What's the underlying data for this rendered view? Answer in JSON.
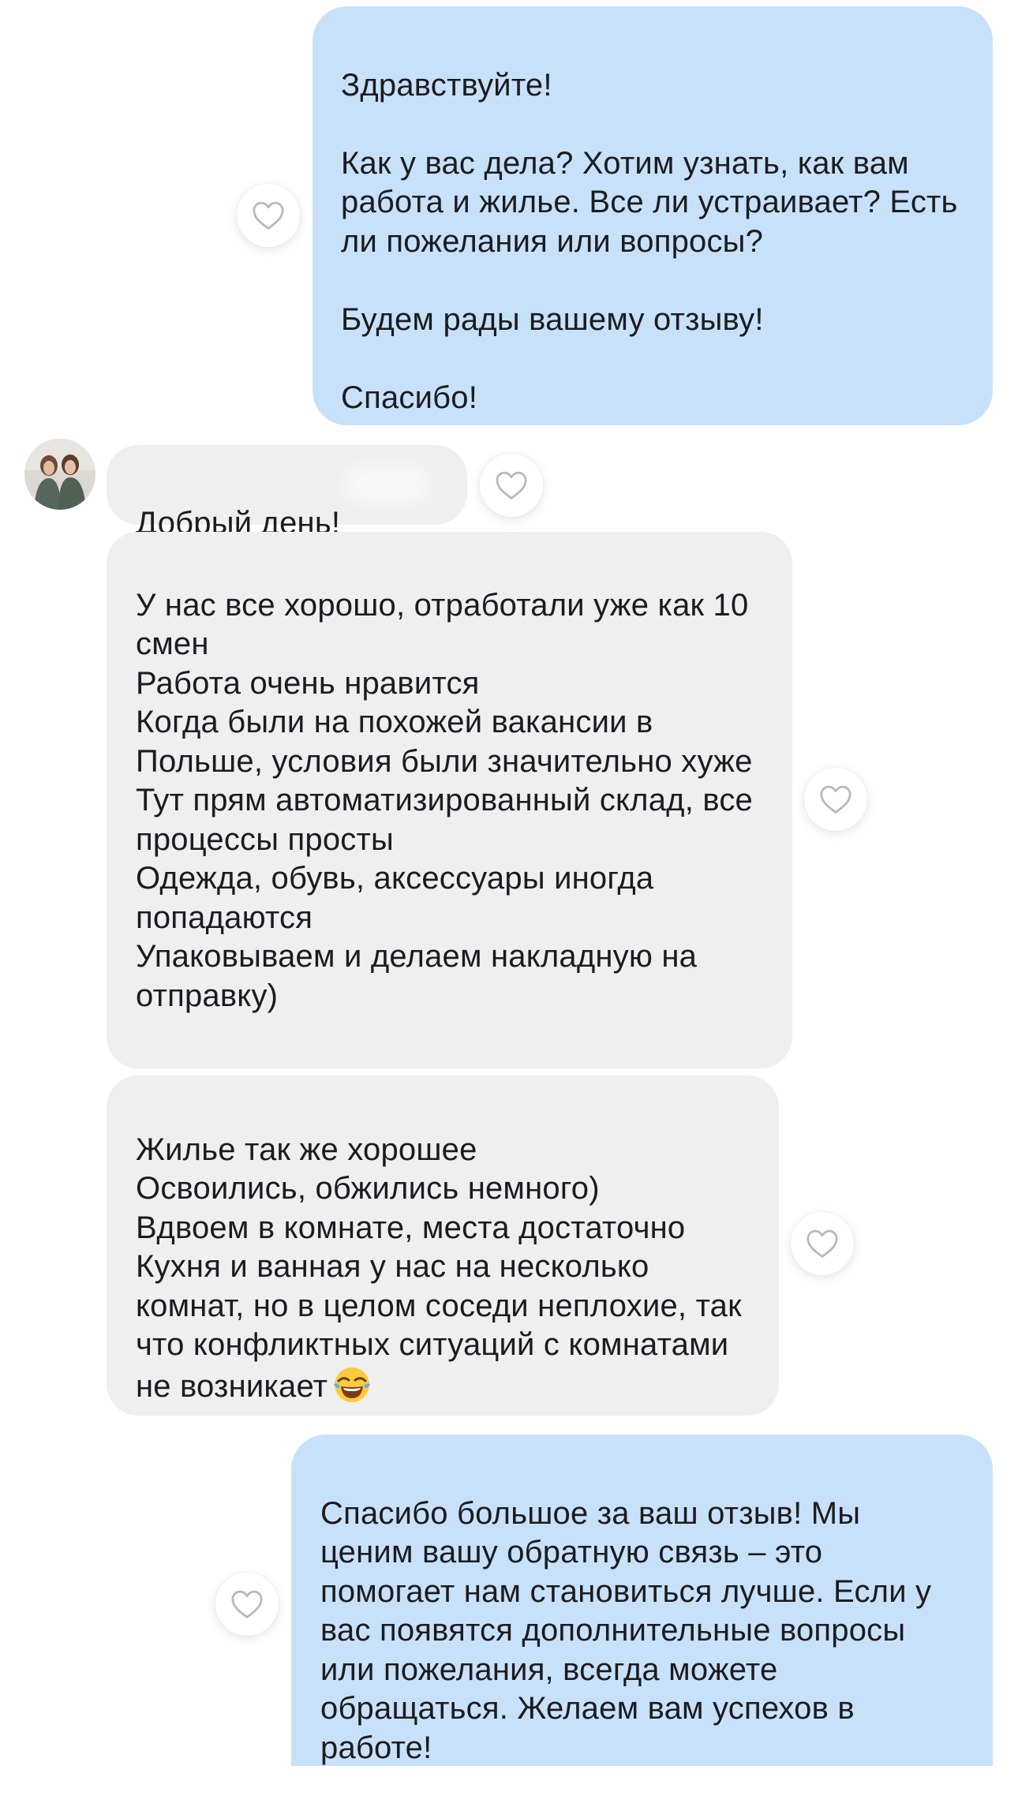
{
  "messages": [
    {
      "direction": "outgoing",
      "text": "Здравствуйте!\n\nКак у вас дела? Хотим узнать, как вам работа и жилье. Все ли устраивает? Есть ли пожелания или вопросы?\n\nБудем рады вашему отзыву!\n\nСпасибо!"
    },
    {
      "direction": "incoming",
      "text": "Добрый день!"
    },
    {
      "direction": "incoming",
      "text": "У нас все хорошо, отработали уже как 10 смен\nРабота очень нравится\nКогда были на похожей вакансии в Польше, условия были значительно хуже\nТут прям автоматизированный склад, все процессы просты\nОдежда, обувь, аксессуары иногда попадаются\nУпаковываем и делаем накладную на отправку)"
    },
    {
      "direction": "incoming",
      "text": "Жилье так же хорошее\nОсвоились, обжились немного)\nВдвоем в комнате, места достаточно\nКухня и ванная  у нас на несколько комнат, но в целом соседи неплохие, так что конфликтных ситуаций с комнатами не возникает",
      "emoji": "face-with-tears-of-joy"
    },
    {
      "direction": "outgoing",
      "text": "Спасибо большое за ваш отзыв! Мы ценим вашу обратную связь – это помогает нам становиться лучше. Если у вас появятся дополнительные вопросы или пожелания, всегда можете обращаться. Желаем вам успехов в работе!"
    }
  ],
  "icons": {
    "like": "heart-outline-icon",
    "avatar": "user-avatar-photo"
  },
  "colors": {
    "outgoing_bubble": "#c8e1fb",
    "incoming_bubble": "#efefef",
    "text": "#1c1c1e",
    "heart_stroke": "#b8b8bd"
  }
}
